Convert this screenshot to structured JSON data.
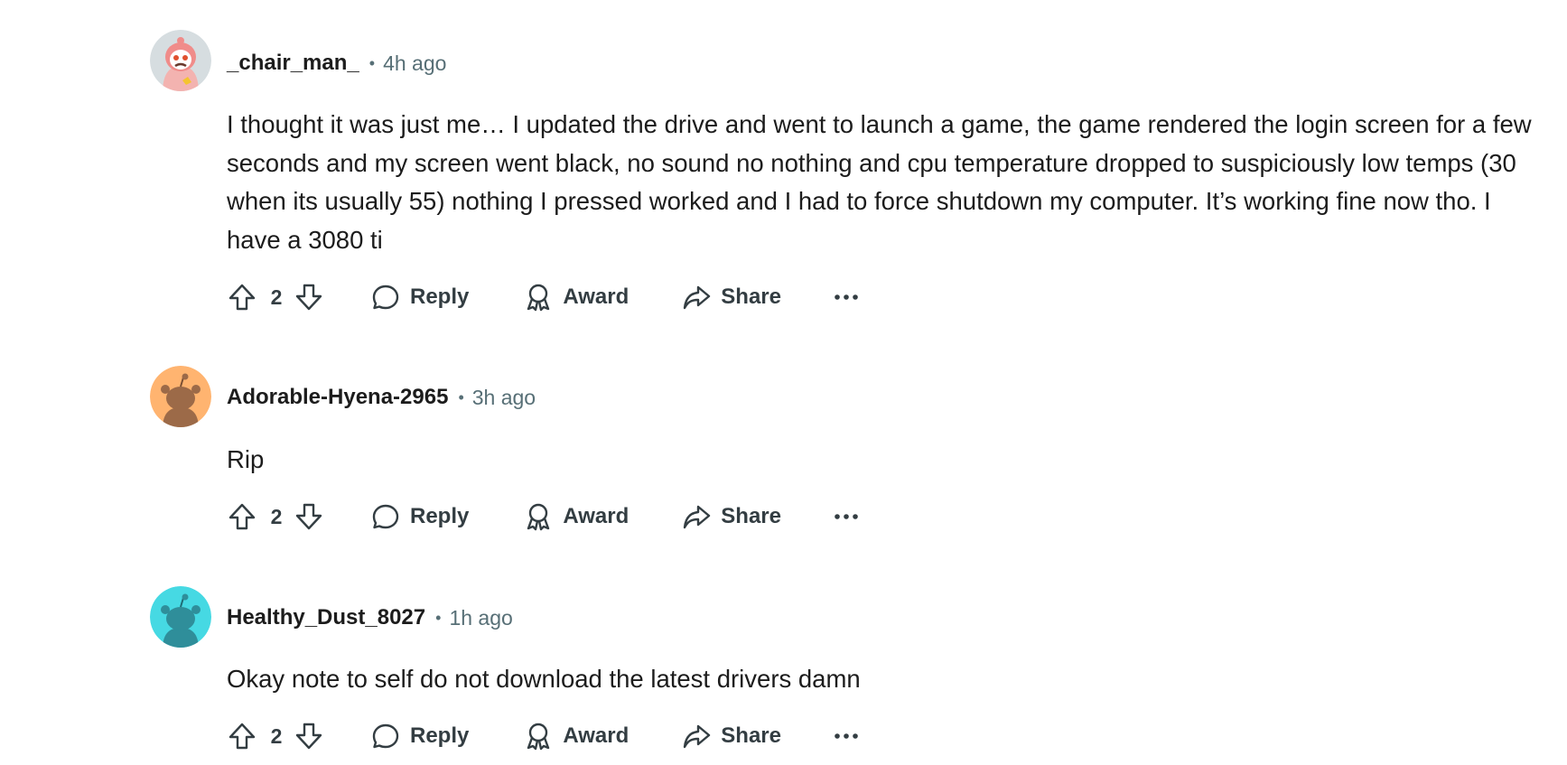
{
  "comments": [
    {
      "author": "_chair_man_",
      "time": "4h ago",
      "body": "I thought it was just me… I updated the drive and went to launch a game, the game rendered the login screen for a few seconds and my screen went black, no sound no nothing and cpu temperature dropped to suspiciously low temps (30 when its usually 55) nothing I pressed worked and I had to force shutdown my computer. It’s working fine now tho. I have a 3080 ti",
      "score": "2",
      "avatar": {
        "icon": "snoo-avatar-pink-hood",
        "bg_color": "#d6dde0"
      }
    },
    {
      "author": "Adorable-Hyena-2965",
      "time": "3h ago",
      "body": "Rip",
      "score": "2",
      "avatar": {
        "icon": "snoo-avatar-orange",
        "bg_color": "#ffb470"
      }
    },
    {
      "author": "Healthy_Dust_8027",
      "time": "1h ago",
      "body": "Okay note to self do not download the latest drivers damn",
      "score": "2",
      "avatar": {
        "icon": "snoo-avatar-teal",
        "bg_color": "#46d9e3"
      }
    }
  ],
  "actions": {
    "reply_label": "Reply",
    "award_label": "Award",
    "share_label": "Share",
    "separator": "•"
  },
  "colors": {
    "text": "#1c1c1c",
    "meta": "#576f76",
    "action": "#333d42"
  }
}
